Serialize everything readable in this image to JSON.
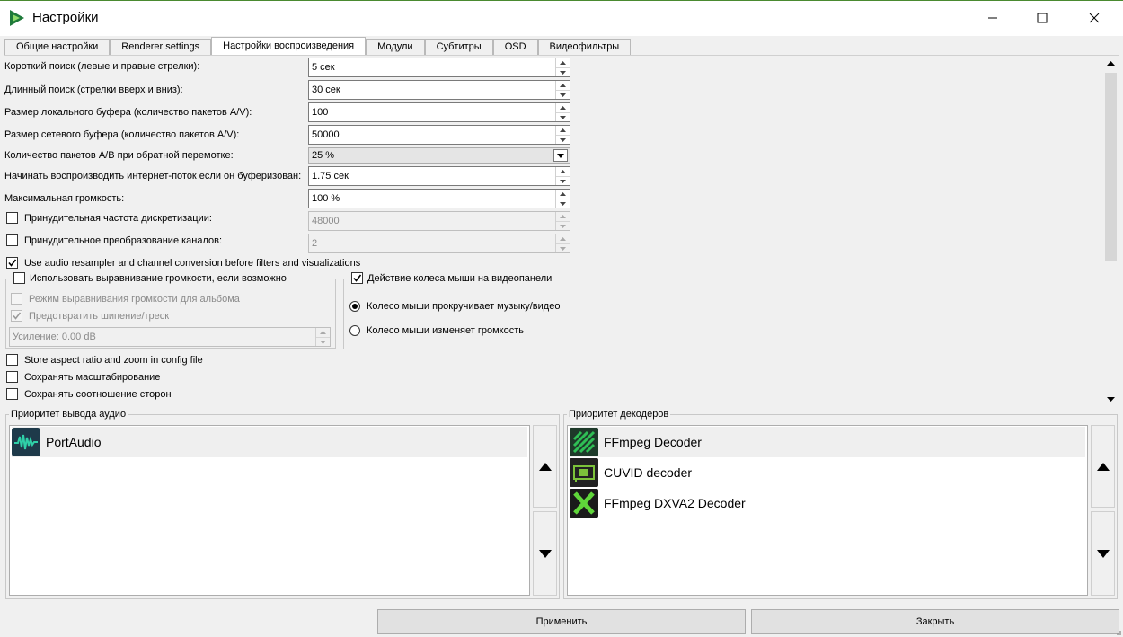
{
  "window": {
    "title": "Настройки",
    "controls": {
      "minimize": "—",
      "maximize": "☐",
      "close": "✕"
    }
  },
  "tabs": [
    {
      "label": "Общие настройки"
    },
    {
      "label": "Renderer settings"
    },
    {
      "label": "Настройки воспроизведения",
      "active": true
    },
    {
      "label": "Модули"
    },
    {
      "label": "Субтитры"
    },
    {
      "label": "OSD"
    },
    {
      "label": "Видеофильтры"
    }
  ],
  "settings": {
    "short_seek": {
      "label": "Короткий поиск (левые и правые стрелки):",
      "value": "5 сек"
    },
    "long_seek": {
      "label": "Длинный поиск (стрелки вверх и вниз):",
      "value": "30 сек"
    },
    "local_buffer": {
      "label": "Размер локального буфера (количество пакетов A/V):",
      "value": "100"
    },
    "network_buffer": {
      "label": "Размер сетевого буфера (количество пакетов A/V):",
      "value": "50000"
    },
    "backward_packets": {
      "label": "Количество пакетов A/B при обратной перемотке:",
      "value": "25 %"
    },
    "stream_buffered": {
      "label": "Начинать воспроизводить интернет-поток если он буферизован:",
      "value": "1.75 сек"
    },
    "max_volume": {
      "label": "Максимальная громкость:",
      "value": "100 %"
    },
    "force_samplerate": {
      "label": "Принудительная частота дискретизации:",
      "value": "48000",
      "checked": false
    },
    "force_channels": {
      "label": "Принудительное преобразование каналов:",
      "value": "2",
      "checked": false
    },
    "resampler": {
      "label": "Use audio resampler and channel conversion before filters and visualizations",
      "checked": true
    },
    "normalization": {
      "label": "Использовать выравнивание громкости, если возможно",
      "checked": false,
      "album_mode": {
        "label": "Режим выравнивания громкости для альбома",
        "checked": false
      },
      "prevent_clipping": {
        "label": "Предотвратить шипение/треск",
        "checked": true
      },
      "gain": {
        "value": "Усиление: 0.00 dB"
      }
    },
    "wheel": {
      "label": "Действие колеса мыши на видеопанели",
      "checked": true,
      "option_scroll": {
        "label": "Колесо мыши прокручивает музыку/видео",
        "selected": true
      },
      "option_volume": {
        "label": "Колесо мыши изменяет громкость",
        "selected": false
      }
    },
    "store_aspect": {
      "label": "Store aspect ratio and zoom in config file",
      "checked": false
    },
    "keep_zoom": {
      "label": "Сохранять масштабирование",
      "checked": false
    },
    "keep_ratio": {
      "label": "Сохранять соотношение сторон",
      "checked": false
    }
  },
  "audio_priority": {
    "title": "Приоритет вывода аудио",
    "items": [
      {
        "label": "PortAudio",
        "icon": "waveform-icon",
        "selected": true
      }
    ]
  },
  "decoder_priority": {
    "title": "Приоритет декодеров",
    "items": [
      {
        "label": "FFmpeg Decoder",
        "icon": "ffmpeg-icon",
        "selected": true
      },
      {
        "label": "CUVID decoder",
        "icon": "gpu-card-icon",
        "selected": false
      },
      {
        "label": "FFmpeg DXVA2 Decoder",
        "icon": "dxva-x-icon",
        "selected": false
      }
    ]
  },
  "buttons": {
    "apply": "Применить",
    "close": "Закрыть"
  },
  "colors": {
    "accent": "#2e9a8f",
    "icon_bg": "#1e3a4a"
  }
}
